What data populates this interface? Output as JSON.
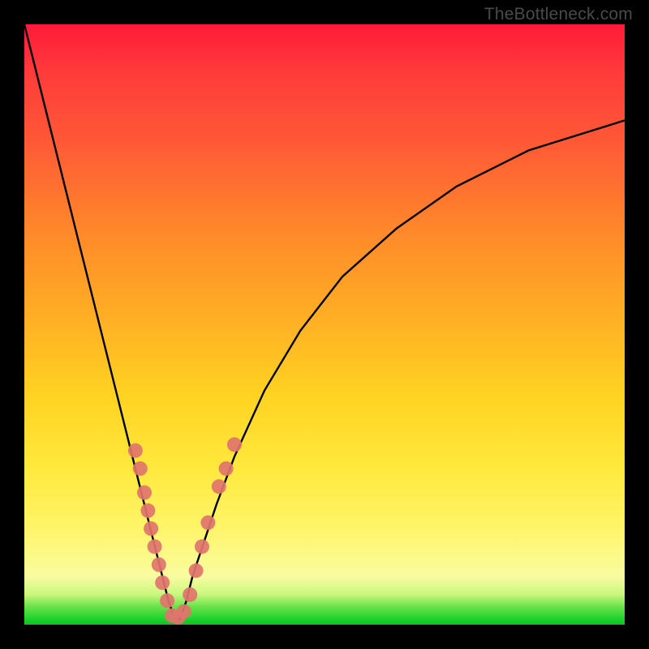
{
  "watermark": "TheBottleneck.com",
  "colors": {
    "frame": "#000000",
    "curve": "#000000",
    "dot": "#e0746d",
    "gradient_stops": [
      "#ff1a3a",
      "#ff3b3b",
      "#ff5a36",
      "#ff8a2a",
      "#ffb224",
      "#ffd321",
      "#ffe93d",
      "#fff56a",
      "#f8fca0",
      "#c8f77e",
      "#6be24c",
      "#1fd32e",
      "#10c020"
    ]
  },
  "chart_data": {
    "type": "line",
    "title": "",
    "xlabel": "",
    "ylabel": "",
    "xlim": [
      0,
      100
    ],
    "ylim": [
      0,
      100
    ],
    "grid": false,
    "note": "Axes are unlabeled in the image; values are normalized 0-100 based on plot-area pixel coordinates (x left→right, y bottom→top). Curve is a V-shaped response with minimum near x≈25.",
    "series": [
      {
        "name": "curve",
        "x": [
          0,
          3,
          6,
          9,
          12,
          15,
          18,
          20,
          22,
          23,
          24,
          25,
          26,
          27,
          28,
          30,
          32,
          35,
          40,
          46,
          53,
          62,
          72,
          84,
          100
        ],
        "y": [
          100,
          88,
          76,
          64,
          52,
          40,
          28,
          20,
          12,
          8,
          4,
          1,
          1,
          4,
          8,
          14,
          20,
          28,
          39,
          49,
          58,
          66,
          73,
          79,
          84
        ]
      }
    ],
    "marker_clusters": {
      "note": "Salmon dots along the lower arms of the V.",
      "left_arm": [
        {
          "x": 18.5,
          "y": 29
        },
        {
          "x": 19.3,
          "y": 26
        },
        {
          "x": 20.0,
          "y": 22
        },
        {
          "x": 20.6,
          "y": 19
        },
        {
          "x": 21.1,
          "y": 16
        },
        {
          "x": 21.7,
          "y": 13
        },
        {
          "x": 22.4,
          "y": 10
        },
        {
          "x": 23.0,
          "y": 7
        },
        {
          "x": 23.8,
          "y": 4
        }
      ],
      "bottom": [
        {
          "x": 24.6,
          "y": 1.5
        },
        {
          "x": 25.6,
          "y": 1.2
        },
        {
          "x": 26.6,
          "y": 2.2
        }
      ],
      "right_arm": [
        {
          "x": 27.6,
          "y": 5
        },
        {
          "x": 28.6,
          "y": 9
        },
        {
          "x": 29.6,
          "y": 13
        },
        {
          "x": 30.6,
          "y": 17
        },
        {
          "x": 32.4,
          "y": 23
        },
        {
          "x": 33.6,
          "y": 26
        },
        {
          "x": 35.0,
          "y": 30
        }
      ]
    }
  }
}
